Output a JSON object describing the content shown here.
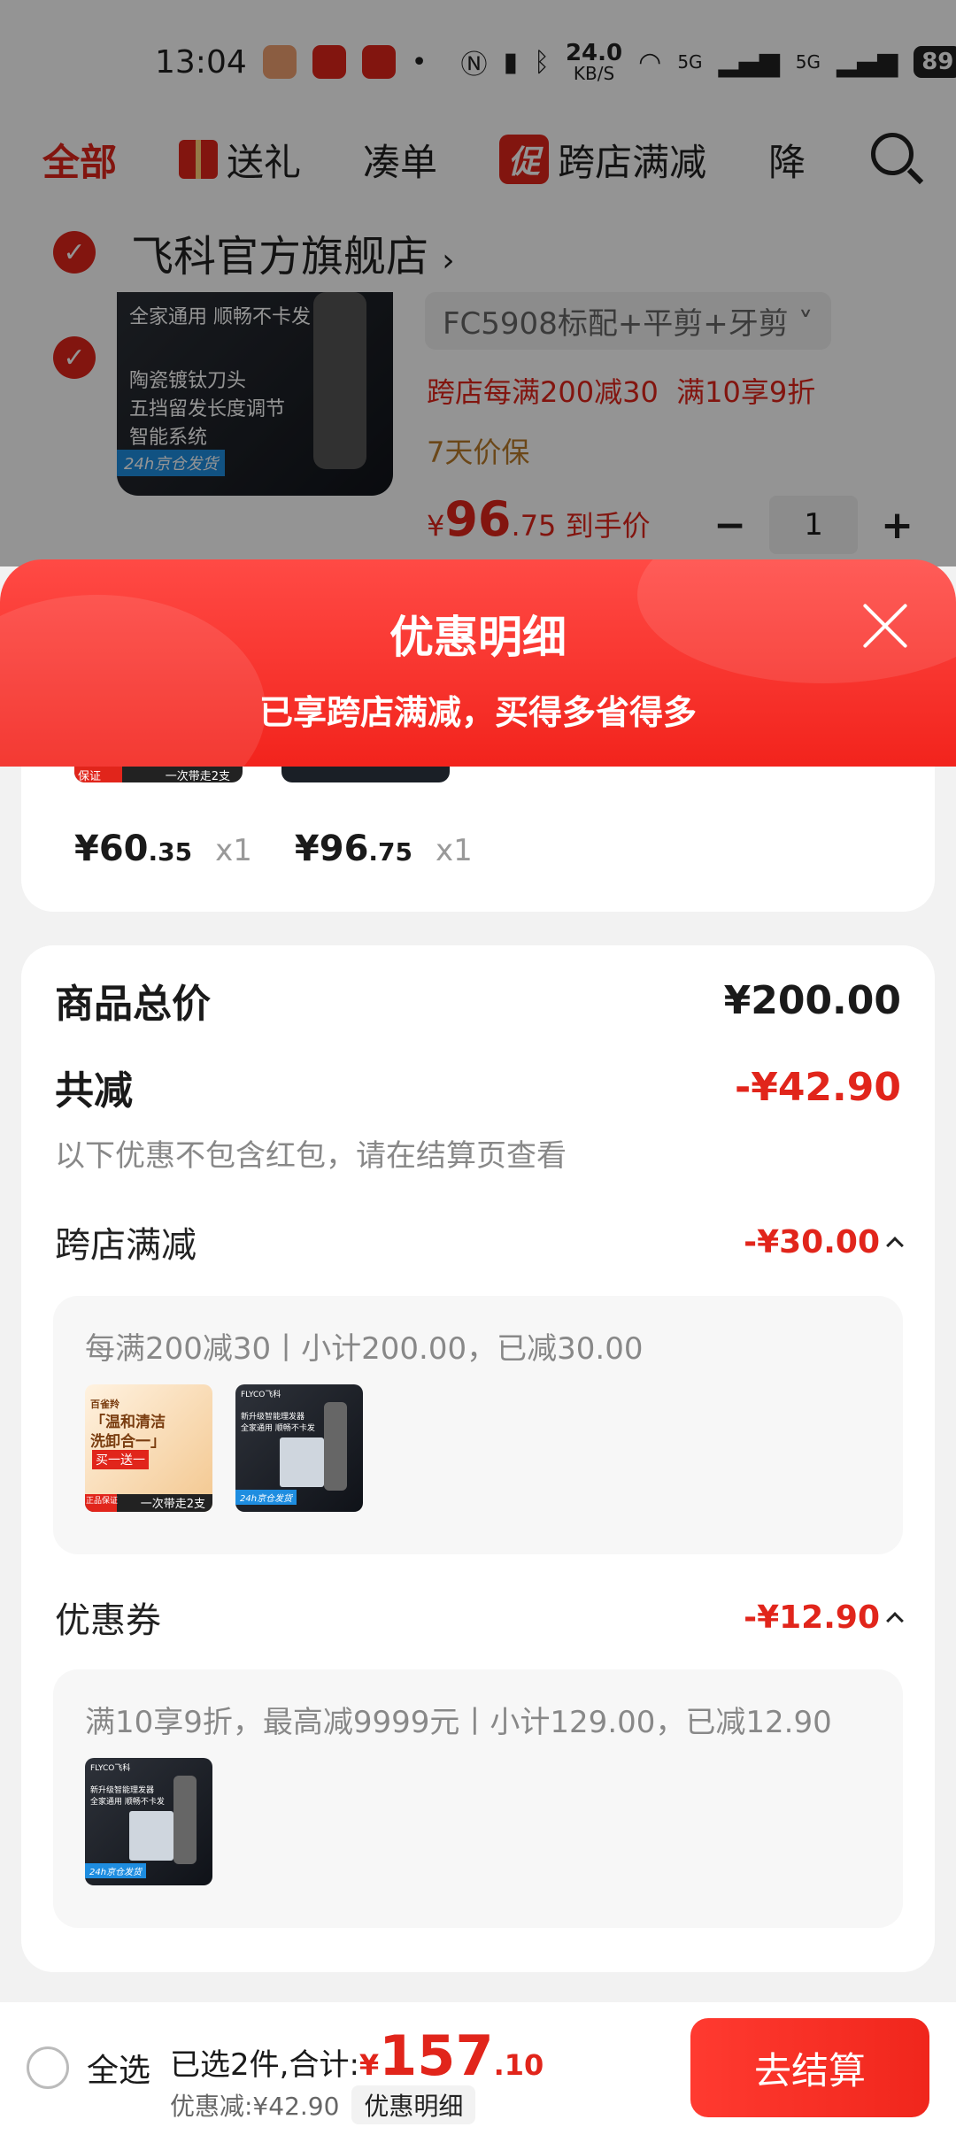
{
  "status_bar": {
    "time": "13:04",
    "net_speed": "24.0",
    "net_unit": "KB/S",
    "net1": "5G",
    "net2": "5G",
    "battery": "89"
  },
  "tabs": [
    {
      "label": "全部",
      "active": true
    },
    {
      "label": "送礼",
      "icon": "gift-icon"
    },
    {
      "label": "凑单"
    },
    {
      "label": "跨店满减",
      "badge": "促"
    },
    {
      "label": "降"
    }
  ],
  "store": {
    "name": "飞科官方旗舰店",
    "arrow": "›"
  },
  "product": {
    "img_text_1": "全家通用 顺畅不卡发",
    "img_text_2": "陶瓷镀钛刀头",
    "img_text_3": "五挡留发长度调节",
    "img_text_4": "智能系统",
    "img_tag": "24h京仓发货",
    "sku": "FC5908标配+平剪+牙剪",
    "promo_1": "跨店每满200减30",
    "promo_2": "满10享9折",
    "price_protect": "7天价保",
    "price_currency": "¥",
    "price_int": "96",
    "price_dec": ".75",
    "price_suffix": "到手价",
    "qty_minus": "−",
    "qty": "1",
    "qty_plus": "+"
  },
  "sheet": {
    "title": "优惠明细",
    "subtitle": "已享跨店满减，买得多省得多",
    "strip_text_left_badge": "保证",
    "strip_text_left": "一次带走2支",
    "items": [
      {
        "currency": "¥",
        "int": "60",
        "dec": ".35",
        "qty": "x1"
      },
      {
        "currency": "¥",
        "int": "96",
        "dec": ".75",
        "qty": "x1"
      }
    ],
    "total_label": "商品总价",
    "total_value": "¥200.00",
    "reduce_label": "共减",
    "reduce_value": "-¥42.90",
    "reduce_note": "以下优惠不包含红包，请在结算页查看",
    "cross_label": "跨店满减",
    "cross_value": "-¥30.00",
    "cross_detail": "每满200减30丨小计200.00，已减30.00",
    "coupon_label": "优惠券",
    "coupon_value": "-¥12.90",
    "coupon_detail": "满10享9折，最高减9999元丨小计129.00，已减12.90",
    "cream_thumb": {
      "brand": "百雀羚",
      "line1": "「温和清洁",
      "line2": "洗卸合一」",
      "badge": "买一送一",
      "corner": "正品保证",
      "foot": "一次带走2支"
    },
    "dark_thumb": {
      "brand": "FLYCO飞科",
      "line1": "新升级智能理发器",
      "line2": "全家通用 顺畅不卡发",
      "tag": "24h京仓发货"
    }
  },
  "bottom_bar": {
    "select_all": "全选",
    "selected_text": "已选2件,合计:",
    "currency": "¥",
    "total_int": "157",
    "total_dec": ".10",
    "savings_text": "优惠减:¥42.90",
    "detail_btn": "优惠明细",
    "checkout": "去结算"
  },
  "colors": {
    "brand_red": "#e1251b",
    "header_red": "#f2231c"
  }
}
